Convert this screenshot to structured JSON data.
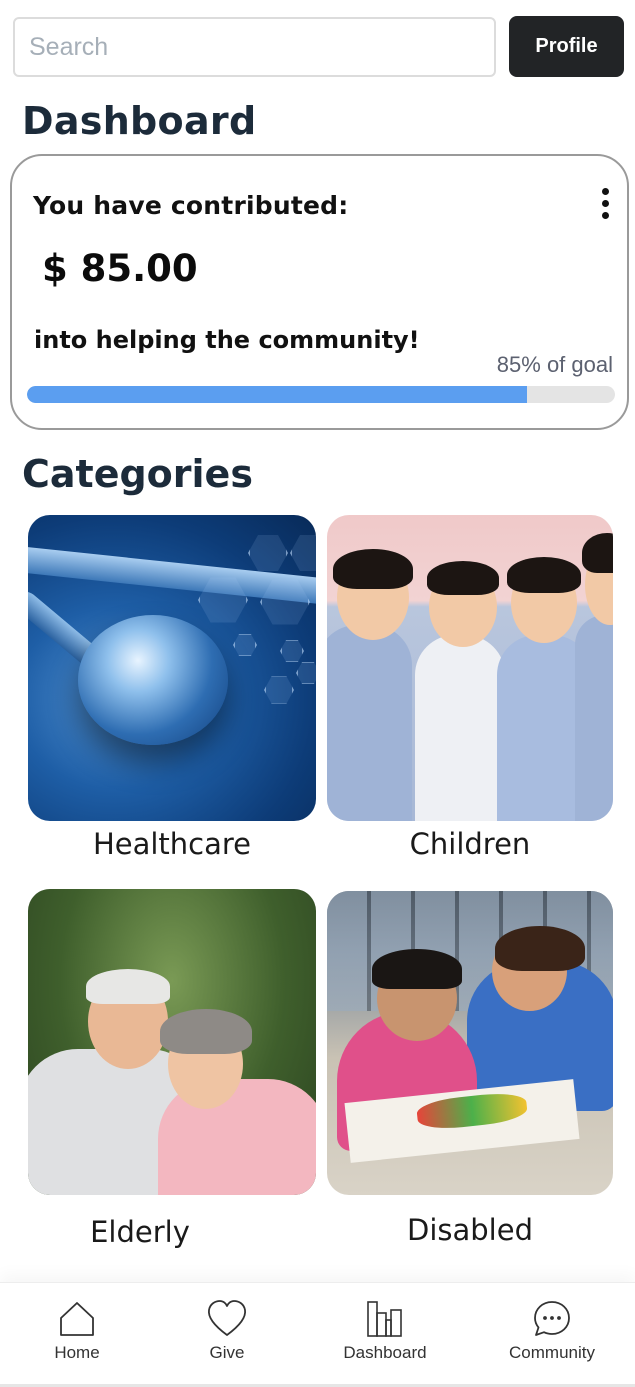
{
  "search": {
    "placeholder": "Search",
    "value": ""
  },
  "header": {
    "profile_label": "Profile"
  },
  "dashboard": {
    "title": "Dashboard",
    "contribution": {
      "heading": "You have contributed:",
      "amount": "$ 85.00",
      "subtext": "into helping the community!",
      "goal_text": "85% of goal",
      "goal_percent": 85
    }
  },
  "categories": {
    "title": "Categories",
    "items": [
      {
        "label": "Healthcare"
      },
      {
        "label": "Children"
      },
      {
        "label": "Elderly"
      },
      {
        "label": "Disabled"
      }
    ]
  },
  "bottom_nav": {
    "items": [
      {
        "label": "Home",
        "icon": "home-icon"
      },
      {
        "label": "Give",
        "icon": "heart-icon"
      },
      {
        "label": "Dashboard",
        "icon": "bar-chart-icon"
      },
      {
        "label": "Community",
        "icon": "chat-bubble-icon"
      }
    ]
  },
  "colors": {
    "progress_fill": "#5b9ef0",
    "progress_track": "#e4e4e4",
    "profile_button": "#222426",
    "title_text": "#1c2b3a"
  }
}
